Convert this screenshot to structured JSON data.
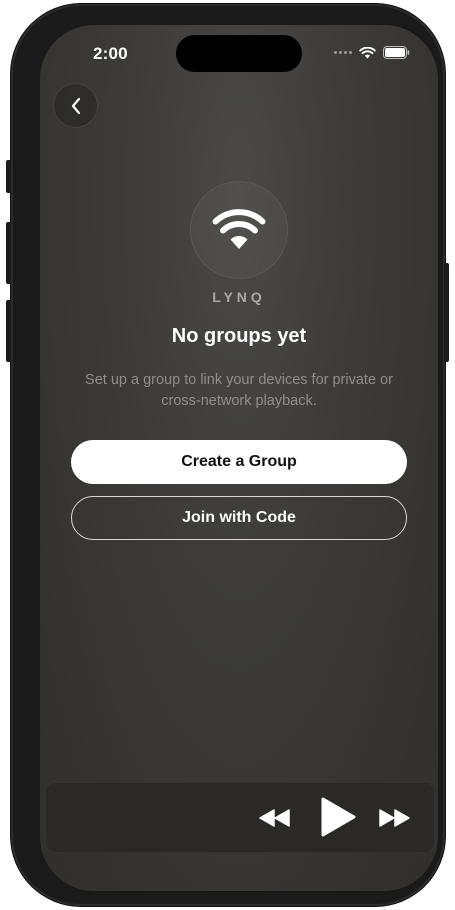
{
  "status_bar": {
    "time": "2:00",
    "icons": [
      "signal-dots-icon",
      "wifi-icon",
      "battery-icon"
    ]
  },
  "nav": {
    "back_icon": "chevron-left-icon"
  },
  "empty_state": {
    "logo_icon": "wifi-icon",
    "brand": "LYNQ",
    "title": "No groups yet",
    "description": "Set up a group to link your devices for private or cross-network playback."
  },
  "actions": {
    "create_label": "Create a Group",
    "join_label": "Join with Code"
  },
  "player": {
    "rewind_icon": "rewind-icon",
    "play_icon": "play-icon",
    "forward_icon": "fast-forward-icon"
  },
  "colors": {
    "background": "#3b3a38",
    "primary_button": "#ffffff",
    "text_primary": "#ffffff",
    "text_secondary": "#8f8e8b"
  }
}
